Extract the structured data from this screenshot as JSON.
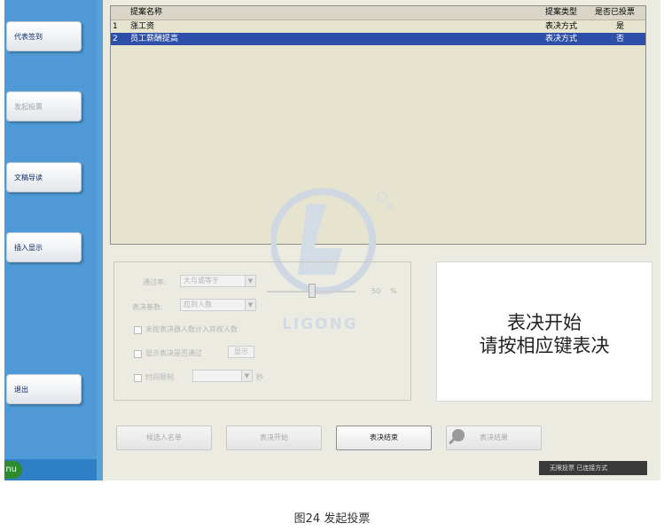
{
  "sidebar": {
    "items": [
      {
        "label": "代表签到"
      },
      {
        "label": "发起投票"
      },
      {
        "label": "文稿导读"
      },
      {
        "label": "插入显示"
      },
      {
        "label": "退出"
      }
    ],
    "start_label": "nu"
  },
  "proposals": {
    "columns": [
      "提案名称",
      "提案类型",
      "是否已投票"
    ],
    "rows": [
      {
        "index": "1",
        "name": "涨工资",
        "type": "表决方式",
        "voted": "是"
      },
      {
        "index": "2",
        "name": "员工薪酬提高",
        "type": "表决方式",
        "voted": "否"
      }
    ]
  },
  "settings": {
    "pass_rate_label": "通过率:",
    "pass_rate_value": "大与或等于",
    "vote_base_label": "表决基数:",
    "vote_base_value": "应到人数",
    "threshold_value": "50",
    "threshold_unit": "%",
    "option_abstain": "未按表决器人数计入弃权人数",
    "option_show_pass": "显示表决是否通过",
    "show_button": "显示",
    "option_time_limit": "时间限制",
    "time_unit": "秒"
  },
  "status": {
    "line1": "表决开始",
    "line2": "请按相应键表决"
  },
  "buttons": {
    "select_person": "候选人名单",
    "vote_start": "表决开始",
    "vote_end": "表决结束",
    "vote_result": "表决结果"
  },
  "watermark": {
    "text": "LIGONG",
    "registered": "®"
  },
  "statusbar": {
    "text": "无限投票  已连接方式"
  },
  "caption": "图24 发起投票"
}
